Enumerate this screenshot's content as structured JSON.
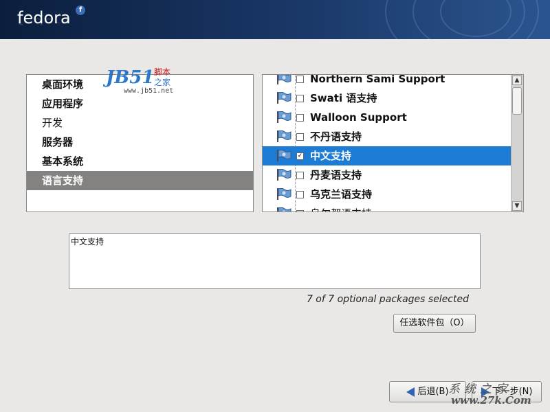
{
  "header": {
    "logo_text": "fedora",
    "logo_mark": "f"
  },
  "categories": {
    "items": [
      {
        "label": "桌面环境",
        "bold": true,
        "selected": false
      },
      {
        "label": "应用程序",
        "bold": true,
        "selected": false
      },
      {
        "label": "开发",
        "bold": false,
        "selected": false
      },
      {
        "label": "服务器",
        "bold": true,
        "selected": false
      },
      {
        "label": "基本系统",
        "bold": true,
        "selected": false
      },
      {
        "label": "语言支持",
        "bold": true,
        "selected": true
      }
    ]
  },
  "packages": {
    "items": [
      {
        "label": "Northern Sami Support",
        "checked": false,
        "bold": true,
        "selected": false,
        "icon": "flag-icon"
      },
      {
        "label": "Swati 语支持",
        "checked": false,
        "bold": true,
        "selected": false,
        "icon": "flag-icon"
      },
      {
        "label": "Walloon Support",
        "checked": false,
        "bold": true,
        "selected": false,
        "icon": "flag-icon"
      },
      {
        "label": "不丹语支持",
        "checked": false,
        "bold": true,
        "selected": false,
        "icon": "flag-icon"
      },
      {
        "label": "中文支持",
        "checked": true,
        "bold": true,
        "selected": true,
        "icon": "flag-icon"
      },
      {
        "label": "丹麦语支持",
        "checked": false,
        "bold": true,
        "selected": false,
        "icon": "flag-icon"
      },
      {
        "label": "乌克兰语支持",
        "checked": false,
        "bold": true,
        "selected": false,
        "icon": "flag-icon"
      },
      {
        "label": "乌尔都语支持",
        "checked": false,
        "bold": false,
        "selected": false,
        "icon": "flag-icon"
      }
    ],
    "scroll_up": "▲",
    "scroll_down": "▼",
    "check_mark": "✓"
  },
  "description": {
    "text": "中文支持"
  },
  "status": {
    "selected_count": "7 of 7 optional packages selected"
  },
  "buttons": {
    "optional_packages": "任选软件包（O）",
    "back": "后退(B)",
    "next": "下一步(N)"
  },
  "watermarks": {
    "jb51_logo": "JB51",
    "jb51_line1": "脚本",
    "jb51_line2": "之家",
    "jb51_url": "www.jb51.net",
    "site2_name": "系统之家",
    "site2_url": "www.27k.Com"
  },
  "colors": {
    "selection_blue": "#1b7bd5",
    "category_selected": "#838281",
    "header_dark": "#0b1e3d"
  }
}
